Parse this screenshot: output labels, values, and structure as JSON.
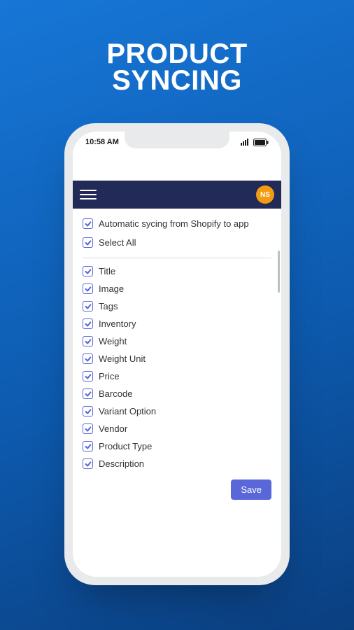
{
  "promo": {
    "line1": "PRODUCT",
    "line2": "SYNCING"
  },
  "status": {
    "time": "10:58 AM"
  },
  "nav": {
    "avatar_initials": "NS"
  },
  "form": {
    "auto_sync_label": "Automatic sycing from Shopify to app",
    "select_all_label": "Select All",
    "fields": [
      {
        "label": "Title"
      },
      {
        "label": "Image"
      },
      {
        "label": "Tags"
      },
      {
        "label": "Inventory"
      },
      {
        "label": "Weight"
      },
      {
        "label": "Weight Unit"
      },
      {
        "label": "Price"
      },
      {
        "label": "Barcode"
      },
      {
        "label": "Variant Option"
      },
      {
        "label": "Vendor"
      },
      {
        "label": "Product Type"
      },
      {
        "label": "Description"
      }
    ],
    "save_label": "Save"
  }
}
